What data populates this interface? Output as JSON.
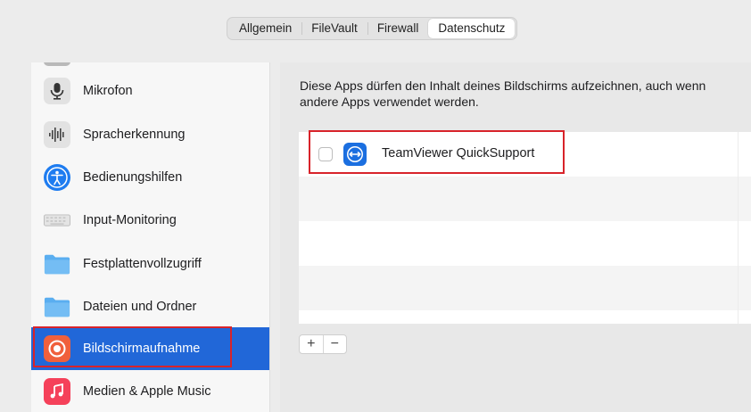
{
  "tabs": [
    {
      "label": "Allgemein",
      "active": false
    },
    {
      "label": "FileVault",
      "active": false
    },
    {
      "label": "Firewall",
      "active": false
    },
    {
      "label": "Datenschutz",
      "active": true
    }
  ],
  "sidebar": {
    "items": [
      {
        "label": "Mikrofon",
        "icon": "microphone-icon"
      },
      {
        "label": "Spracherkennung",
        "icon": "waveform-icon"
      },
      {
        "label": "Bedienungshilfen",
        "icon": "accessibility-icon"
      },
      {
        "label": "Input-Monitoring",
        "icon": "keyboard-icon"
      },
      {
        "label": "Festplattenvollzugriff",
        "icon": "folder-icon"
      },
      {
        "label": "Dateien und Ordner",
        "icon": "folder-icon"
      },
      {
        "label": "Bildschirmaufnahme",
        "icon": "screen-recording-icon",
        "selected": true
      },
      {
        "label": "Medien & Apple Music",
        "icon": "music-icon"
      }
    ]
  },
  "main": {
    "description": "Diese Apps dürfen den Inhalt deines Bildschirms aufzeichnen, auch wenn andere Apps verwendet werden.",
    "apps": [
      {
        "name": "TeamViewer QuickSupport",
        "checked": false,
        "icon": "teamviewer-icon"
      }
    ],
    "add_label": "+",
    "remove_label": "−"
  },
  "colors": {
    "selection": "#2167d8",
    "highlight": "#d8232a",
    "teamviewer": "#1b6fe0"
  }
}
